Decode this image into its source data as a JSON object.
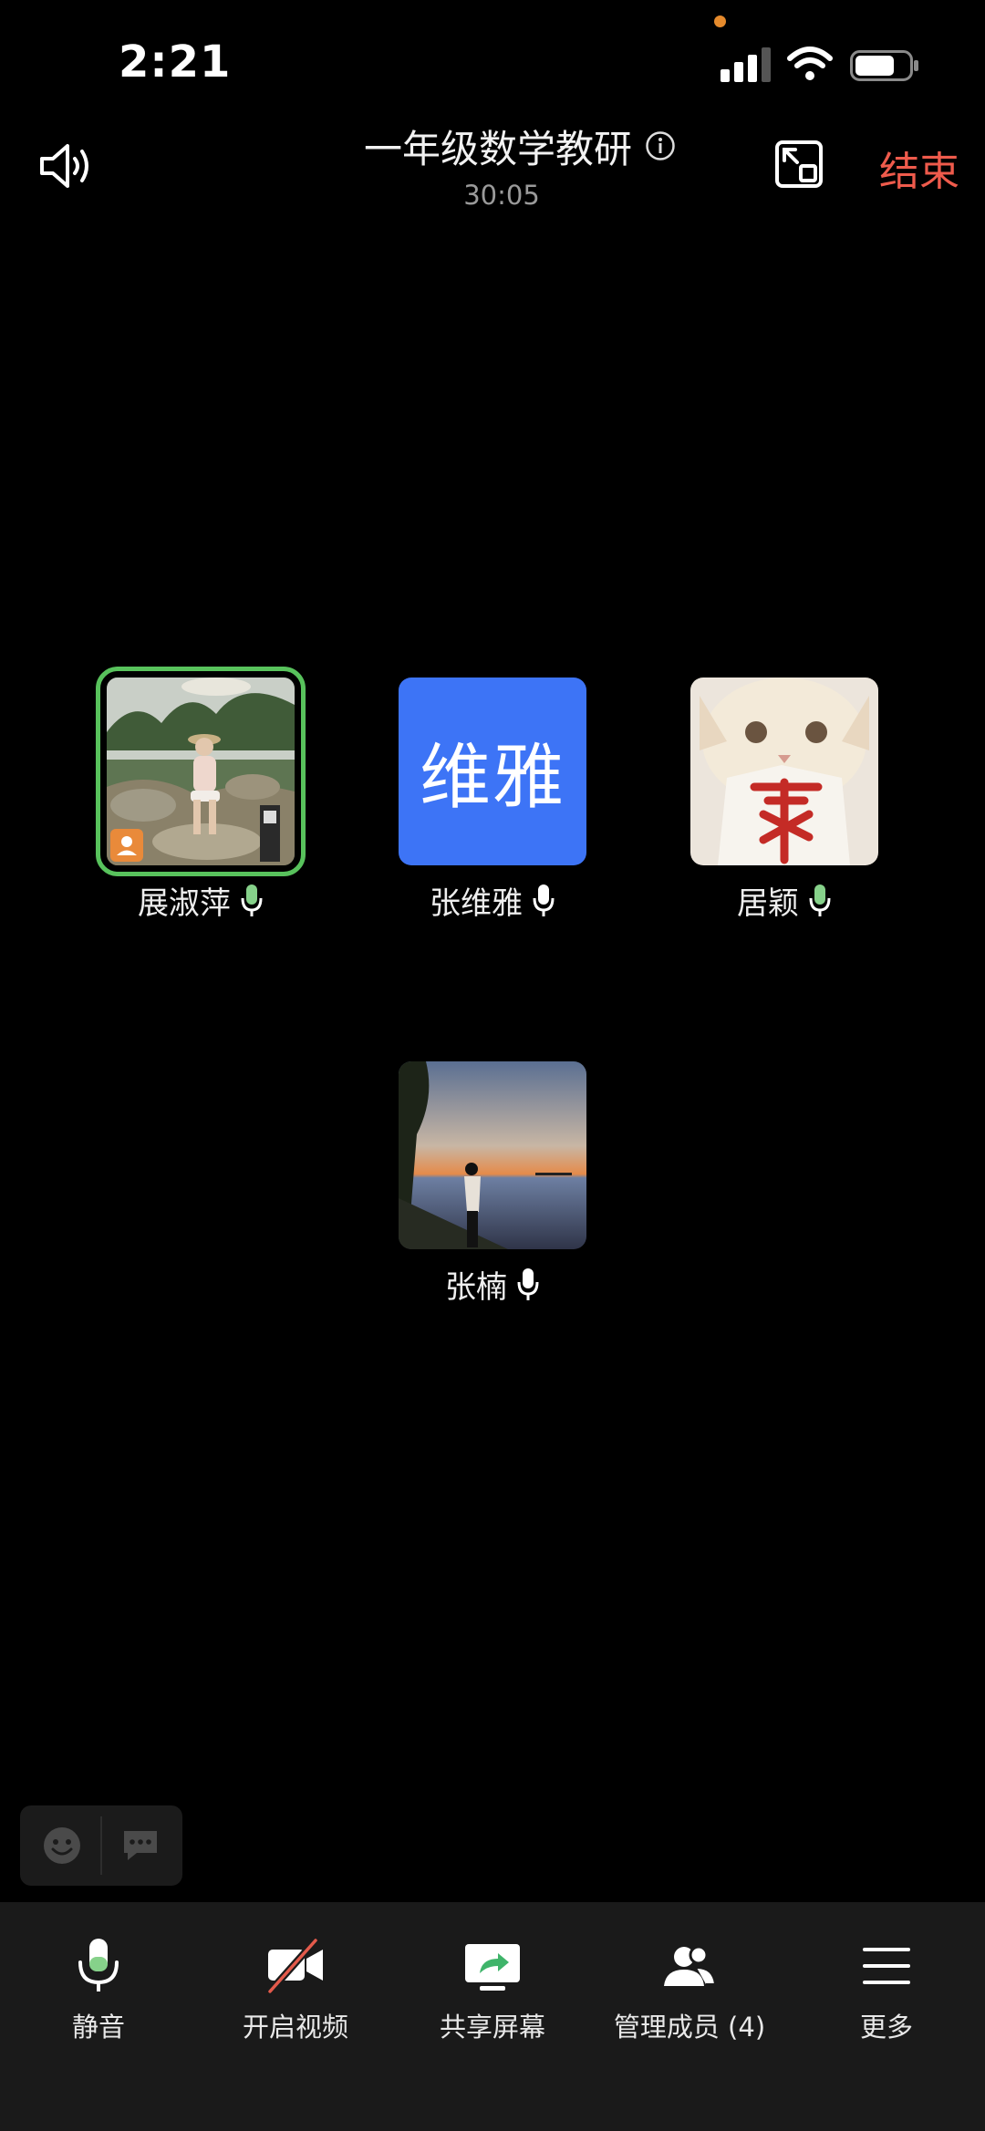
{
  "status": {
    "time": "2:21"
  },
  "header": {
    "title": "一年级数学教研",
    "timer": "30:05",
    "end_label": "结束"
  },
  "participants": [
    {
      "name": "展淑萍",
      "active": true
    },
    {
      "name": "张维雅",
      "avatar_text": "维雅"
    },
    {
      "name": "居颖"
    },
    {
      "name": "张楠"
    }
  ],
  "toolbar": {
    "mute": "静音",
    "video": "开启视频",
    "share": "共享屏幕",
    "members": "管理成员 (4)",
    "more": "更多"
  },
  "colors": {
    "end": "#ef5b4c",
    "active_ring": "#58c25c",
    "avatar_blue": "#3d74f6",
    "mic_green": "#86d18a"
  }
}
